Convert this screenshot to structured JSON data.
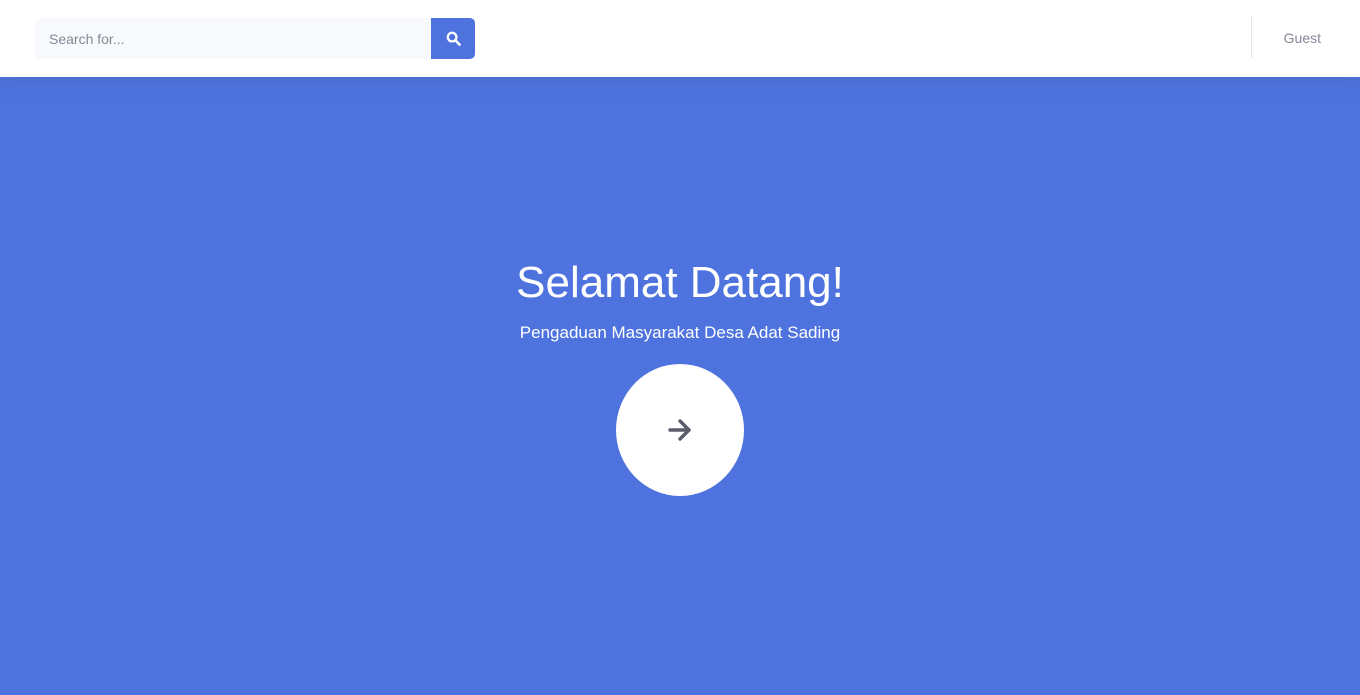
{
  "topbar": {
    "search": {
      "placeholder": "Search for...",
      "value": "",
      "button_icon": "search-icon"
    },
    "user": {
      "name": "Guest"
    }
  },
  "hero": {
    "title": "Selamat Datang!",
    "subtitle": "Pengaduan Masyarakat Desa Adat Sading",
    "enter_icon": "arrow-right-icon"
  },
  "colors": {
    "primary": "#4e73df",
    "topbar_bg": "#ffffff",
    "search_bg": "#f8f9fc",
    "muted_text": "#858796",
    "arrow": "#5a5c69"
  }
}
